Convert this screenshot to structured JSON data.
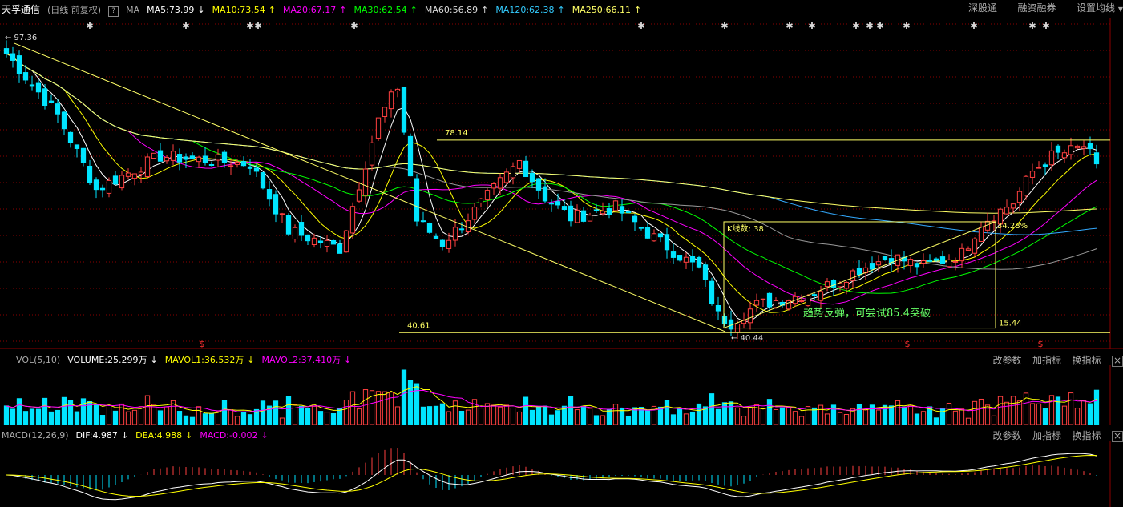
{
  "header": {
    "stock_name": "天孚通信",
    "period_note": "(日线 前复权)",
    "help": "?",
    "ma_label": "MA",
    "ma_items": [
      {
        "text": "MA5:73.99",
        "color": "#ffffff",
        "arrow": "↓"
      },
      {
        "text": "MA10:73.54",
        "color": "#ffff00",
        "arrow": "↑"
      },
      {
        "text": "MA20:67.17",
        "color": "#ff00ff",
        "arrow": "↑"
      },
      {
        "text": "MA30:62.54",
        "color": "#00ff00",
        "arrow": "↑"
      },
      {
        "text": "MA60:56.89",
        "color": "#dddddd",
        "arrow": "↑"
      },
      {
        "text": "MA120:62.38",
        "color": "#33ccff",
        "arrow": "↑"
      },
      {
        "text": "MA250:66.11",
        "color": "#ffff66",
        "arrow": "↑"
      }
    ],
    "menu": [
      "深股通",
      "融资融券",
      "设置均线"
    ]
  },
  "vol_header": {
    "label": "VOL(5,10)",
    "items": [
      {
        "text": "VOLUME:25.299万",
        "color": "#ffffff",
        "arrow": "↓"
      },
      {
        "text": "MAVOL1:36.532万",
        "color": "#ffff00",
        "arrow": "↓"
      },
      {
        "text": "MAVOL2:37.410万",
        "color": "#ff00ff",
        "arrow": "↓"
      }
    ],
    "tools": [
      "改参数",
      "加指标",
      "换指标"
    ]
  },
  "macd_header": {
    "label": "MACD(12,26,9)",
    "items": [
      {
        "text": "DIF:4.987",
        "color": "#ffffff",
        "arrow": "↓"
      },
      {
        "text": "DEA:4.988",
        "color": "#ffff00",
        "arrow": "↓"
      },
      {
        "text": "MACD:-0.002",
        "color": "#ff00ff",
        "arrow": "↓"
      }
    ],
    "tools": [
      "改参数",
      "加指标",
      "换指标"
    ]
  },
  "chart_data": {
    "type": "candlestick",
    "title": "天孚通信 (日线 前复权)",
    "price_range": [
      38,
      102
    ],
    "annotations": {
      "high_label": "97.36",
      "low_label": "40.44",
      "level_high": "78.14",
      "level_low": "40.61",
      "bars_count": "K线数: 38",
      "gain": "34.28%",
      "range_size": "15.44",
      "comment": "趋势反弹，可尝试85.4突破"
    },
    "anchors": [
      {
        "i": 0,
        "close": 95.0
      },
      {
        "i": 8,
        "close": 83.0
      },
      {
        "i": 14,
        "close": 68.5
      },
      {
        "i": 24,
        "close": 75.0
      },
      {
        "i": 38,
        "close": 73.5
      },
      {
        "i": 44,
        "close": 60.5
      },
      {
        "i": 52,
        "close": 57.0
      },
      {
        "i": 58,
        "close": 82.0
      },
      {
        "i": 61,
        "close": 88.5
      },
      {
        "i": 64,
        "close": 62.5
      },
      {
        "i": 68,
        "close": 58.0
      },
      {
        "i": 72,
        "close": 63.0
      },
      {
        "i": 80,
        "close": 74.0
      },
      {
        "i": 84,
        "close": 67.0
      },
      {
        "i": 88,
        "close": 63.0
      },
      {
        "i": 95,
        "close": 65.0
      },
      {
        "i": 100,
        "close": 60.0
      },
      {
        "i": 108,
        "close": 53.0
      },
      {
        "i": 111,
        "close": 44.0
      },
      {
        "i": 113,
        "close": 42.5
      },
      {
        "i": 117,
        "close": 46.0
      },
      {
        "i": 126,
        "close": 48.5
      },
      {
        "i": 133,
        "close": 53.0
      },
      {
        "i": 138,
        "close": 55.5
      },
      {
        "i": 143,
        "close": 53.5
      },
      {
        "i": 149,
        "close": 56.0
      },
      {
        "i": 152,
        "close": 62.0
      },
      {
        "i": 157,
        "close": 66.0
      },
      {
        "i": 160,
        "close": 72.0
      },
      {
        "i": 163,
        "close": 75.0
      },
      {
        "i": 166,
        "close": 76.0
      },
      {
        "i": 168,
        "close": 77.0
      },
      {
        "i": 170,
        "close": 73.5
      }
    ],
    "moving_averages": [
      {
        "name": "MA5",
        "period": 5,
        "color": "#ffffff"
      },
      {
        "name": "MA10",
        "period": 10,
        "color": "#ffff00"
      },
      {
        "name": "MA20",
        "period": 20,
        "color": "#ff00ff"
      },
      {
        "name": "MA30",
        "period": 30,
        "color": "#00ff00"
      },
      {
        "name": "MA60",
        "period": 60,
        "color": "#999999"
      },
      {
        "name": "MA120",
        "period": 120,
        "color": "#33aaff"
      },
      {
        "name": "MA250",
        "period": 250,
        "color": "#ffff66"
      }
    ],
    "colors": {
      "up": "#ff4040",
      "down": "#00e5ff",
      "guide": "#ffff66",
      "grid": "#8b0000"
    }
  }
}
